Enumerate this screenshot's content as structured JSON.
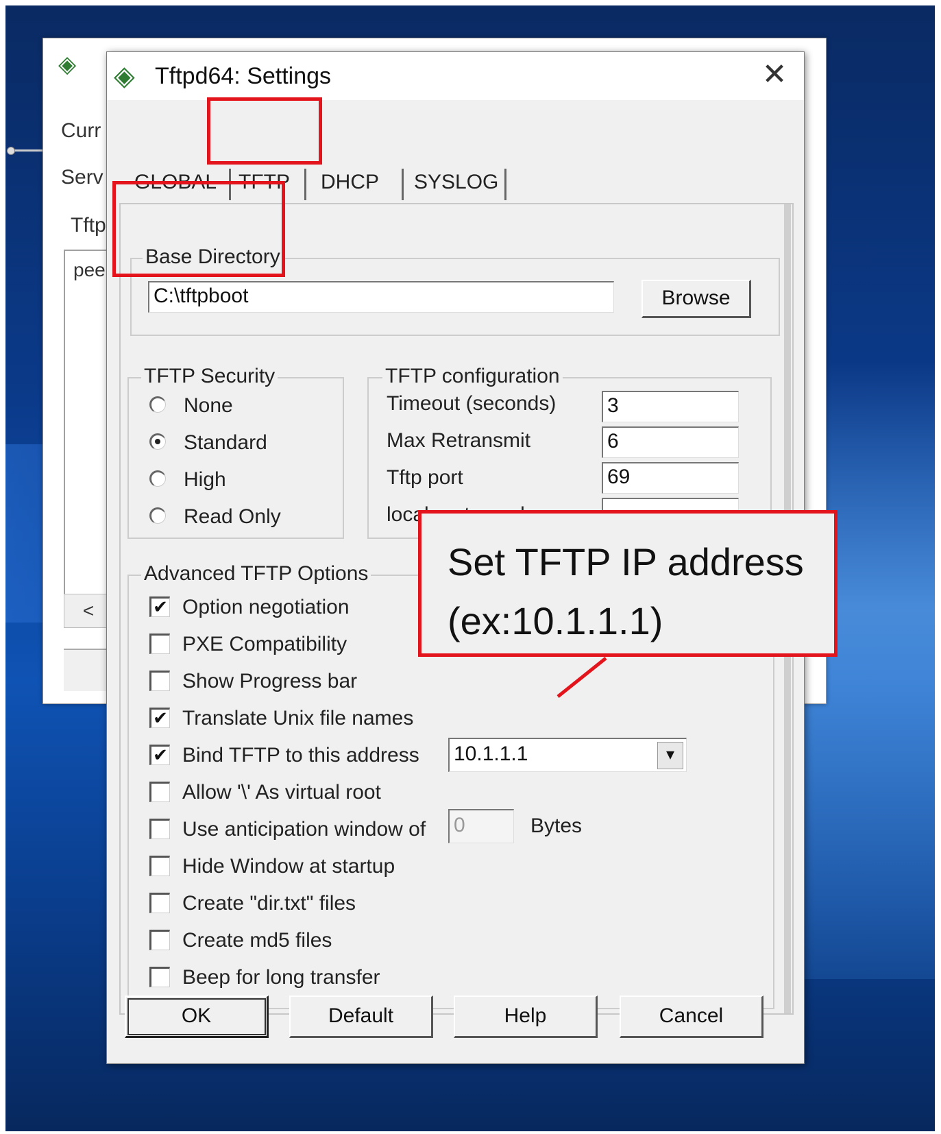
{
  "dialog": {
    "title": "Tftpd64: Settings",
    "close_glyph": "✕",
    "title_icon": "app-icon"
  },
  "tabs": [
    {
      "label": "GLOBAL"
    },
    {
      "label": "TFTP",
      "active": true
    },
    {
      "label": "DHCP"
    },
    {
      "label": "SYSLOG"
    }
  ],
  "base_directory": {
    "legend": "Base Directory",
    "value": "C:\\tftpboot",
    "browse_label": "Browse"
  },
  "security": {
    "legend": "TFTP Security",
    "options": [
      "None",
      "Standard",
      "High",
      "Read Only"
    ],
    "selected": "Standard"
  },
  "configuration": {
    "legend": "TFTP configuration",
    "fields": [
      {
        "label": "Timeout (seconds)",
        "value": "3"
      },
      {
        "label": "Max Retransmit",
        "value": "6"
      },
      {
        "label": "Tftp port",
        "value": "69"
      },
      {
        "label": "local ports pool",
        "value": ""
      }
    ]
  },
  "advanced": {
    "legend": "Advanced TFTP Options",
    "options": [
      {
        "label": "Option negotiation",
        "checked": true
      },
      {
        "label": "PXE Compatibility",
        "checked": false
      },
      {
        "label": "Show Progress bar",
        "checked": false
      },
      {
        "label": "Translate Unix file names",
        "checked": true
      },
      {
        "label": "Bind TFTP to this address",
        "checked": true
      },
      {
        "label": "Allow '\\' As virtual root",
        "checked": false
      },
      {
        "label": "Use anticipation window of",
        "checked": false
      },
      {
        "label": "Hide Window at startup",
        "checked": false
      },
      {
        "label": "Create \"dir.txt\" files",
        "checked": false
      },
      {
        "label": "Create md5 files",
        "checked": false
      },
      {
        "label": "Beep for long transfer",
        "checked": false
      }
    ],
    "bind_address": "10.1.1.1",
    "anticipation_value": "0",
    "anticipation_unit": "Bytes"
  },
  "buttons": {
    "ok": "OK",
    "default": "Default",
    "help": "Help",
    "cancel": "Cancel"
  },
  "annotation": {
    "line1": "Set TFTP IP address",
    "line2": "(ex:10.1.1.1)",
    "color": "#e3141b"
  },
  "background_window": {
    "label_1": "Curr",
    "label_2": "Serv",
    "label_3": "Tftp",
    "list_text": "pee",
    "scroll_glyph": "<"
  },
  "checkmark_glyph": "✔",
  "dropdown_glyph": "▾"
}
